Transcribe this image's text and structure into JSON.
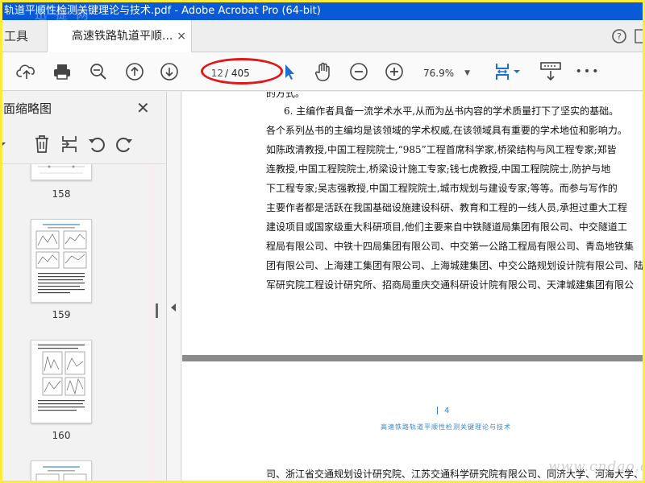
{
  "window": {
    "title": "轨道平顺性检测关键理论与技术.pdf - Adobe Acrobat Pro (64-bit)",
    "watermark": "迅 捷 网"
  },
  "tabs": {
    "tools_label": "工具",
    "doc_tab_label": "高速铁路轨道平顺...",
    "close_glyph": "×"
  },
  "toolbar": {
    "current_page": "12",
    "total_pages": "/ 405",
    "zoom": "76.9%",
    "more": "•••",
    "icons": [
      "upload-icon",
      "print-icon",
      "zoom-out-search-icon",
      "page-up-icon",
      "page-down-icon",
      "select-arrow-icon",
      "hand-icon",
      "zoom-minus-icon",
      "zoom-plus-icon",
      "fit-page-icon",
      "scroll-mode-icon",
      "more-icon"
    ]
  },
  "sidebar": {
    "title": "页面缩略图",
    "close_glyph": "✕",
    "thumbnails": [
      {
        "label": "158"
      },
      {
        "label": "159"
      },
      {
        "label": "160"
      }
    ]
  },
  "document": {
    "lines": [
      "的方式。",
      "6. 主编作者具备一流学术水平,从而为丛书内容的学术质量打下了坚实的基础。",
      "各个系列丛书的主编均是该领域的学术权威,在该领域具有重要的学术地位和影响力。",
      "如陈政清教授,中国工程院院士,“985”工程首席科学家,桥梁结构与风工程专家;郑皆",
      "连教授,中国工程院院士,桥梁设计施工专家;钱七虎教授,中国工程院院士,防护与地",
      "下工程专家;吴志强教授,中国工程院院士,城市规划与建设专家;等等。而参与写作的",
      "主要作者都是活跃在我国基础设施建设科研、教育和工程的一线人员,承担过重大工程",
      "建设项目或国家级重大科研项目,他们主要来自中铁隧道局集团有限公司、中交隧道工",
      "程局有限公司、中铁十四局集团有限公司、中交第一公路工程局有限公司、青岛地铁集",
      "团有限公司、上海建工集团有限公司、上海城建集团、中交公路规划设计院有限公司、陆",
      "军研究院工程设计研究所、招商局重庆交通科研设计院有限公司、天津城建集团有限公"
    ],
    "page_number": "4",
    "running_title": "高速铁路轨道平顺性检测关键理论与技术",
    "next_page_line": "司、浙江省交通规划设计研究院、江苏交通科学研究院有限公司、同济大学、河海大学、",
    "watermark": "www.cndao.com"
  }
}
